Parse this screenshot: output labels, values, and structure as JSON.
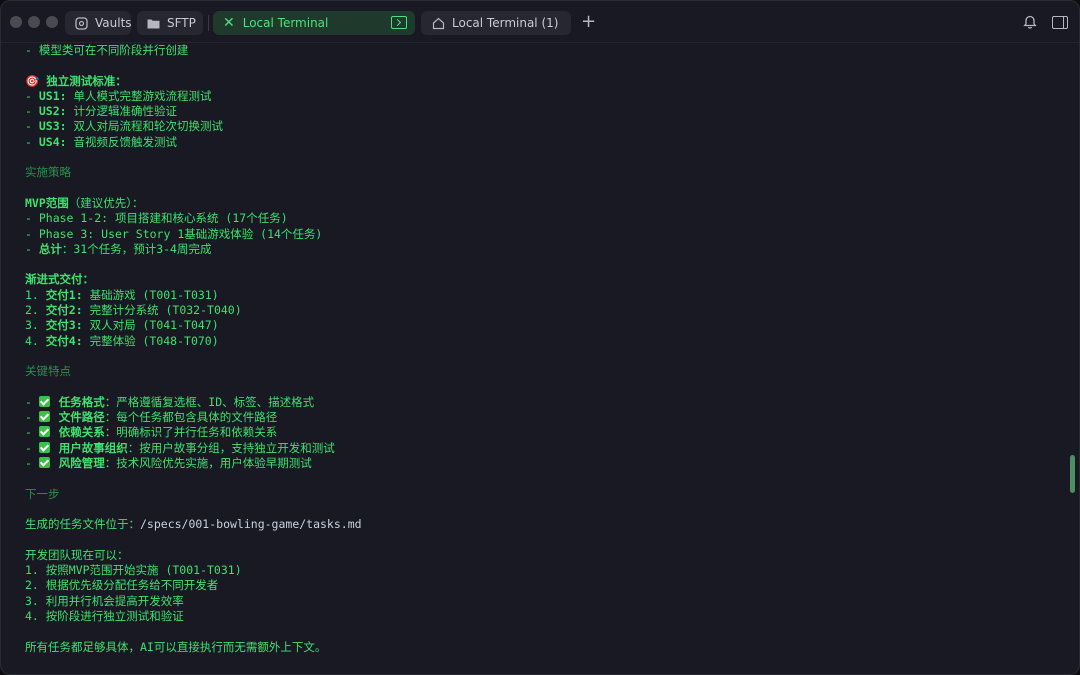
{
  "tabs": {
    "vaults": "Vaults",
    "sftp": "SFTP",
    "active": "Local Terminal",
    "local2": "Local Terminal (1)"
  },
  "terminal": {
    "l01": "- 模型类可在不同阶段并行创建",
    "l03_icon": "🎯",
    "l03": "独立测试标准：",
    "l04_k": "US1:",
    "l04_v": " 单人模式完整游戏流程测试",
    "l05_k": "US2:",
    "l05_v": " 计分逻辑准确性验证",
    "l06_k": "US3:",
    "l06_v": " 双人对局流程和轮次切换测试",
    "l07_k": "US4:",
    "l07_v": " 音视频反馈触发测试",
    "l09": "实施策略",
    "l11_k": "MVP范围",
    "l11_v": "（建议优先）：",
    "l12": "- Phase 1-2: 项目搭建和核心系统 (17个任务)",
    "l13": "- Phase 3: User Story 1基础游戏体验 (14个任务)",
    "l14_k": "总计",
    "l14_v": "：31个任务，预计3-4周完成",
    "l16": "渐进式交付：",
    "l17_k": "交付1:",
    "l17_v": " 基础游戏 (T001-T031)",
    "l18_k": "交付2:",
    "l18_v": " 完整计分系统 (T032-T040)",
    "l19_k": "交付3:",
    "l19_v": " 双人对局 (T041-T047)",
    "l20_k": "交付4:",
    "l20_v": " 完整体验 (T048-T070)",
    "l22": "关键特点",
    "l24_k": "任务格式",
    "l24_v": "：严格遵循复选框、ID、标签、描述格式",
    "l25_k": "文件路径",
    "l25_v": "：每个任务都包含具体的文件路径",
    "l26_k": "依赖关系",
    "l26_v": "：明确标识了并行任务和依赖关系",
    "l27_k": "用户故事组织",
    "l27_v": "：按用户故事分组，支持独立开发和测试",
    "l28_k": "风险管理",
    "l28_v": "：技术风险优先实施，用户体验早期测试",
    "l30": "下一步",
    "l32_a": "生成的任务文件位于：",
    "l32_b": "/specs/001-bowling-game/tasks.md",
    "l34": "开发团队现在可以：",
    "l35": "1. 按照MVP范围开始实施 (T001-T031)",
    "l36": "2. 根据优先级分配任务给不同开发者",
    "l37": "3. 利用并行机会提高开发效率",
    "l38": "4. 按阶段进行独立测试和验证",
    "l40": "所有任务都足够具体，AI可以直接执行而无需额外上下文。"
  }
}
